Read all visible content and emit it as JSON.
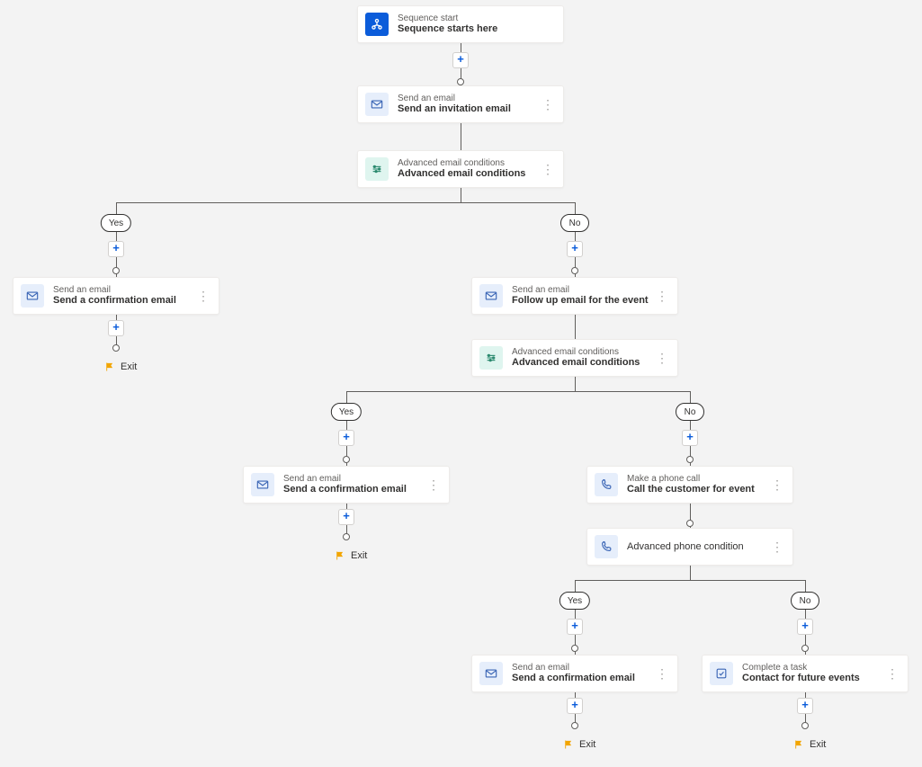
{
  "nodes": {
    "start": {
      "type": "Sequence start",
      "title": "Sequence starts here"
    },
    "invite": {
      "type": "Send an email",
      "title": "Send an invitation email"
    },
    "cond1": {
      "type": "Advanced email conditions",
      "title": "Advanced email conditions"
    },
    "confirmA": {
      "type": "Send an email",
      "title": "Send a confirmation email"
    },
    "follow": {
      "type": "Send an email",
      "title": "Follow up email for the event"
    },
    "cond2": {
      "type": "Advanced email conditions",
      "title": "Advanced email conditions"
    },
    "confirmB": {
      "type": "Send an email",
      "title": "Send a confirmation email"
    },
    "call": {
      "type": "Make a phone call",
      "title": "Call the customer for event"
    },
    "phoneCond": {
      "type": "",
      "title": "Advanced phone condition"
    },
    "confirmC": {
      "type": "Send an email",
      "title": "Send a confirmation email"
    },
    "task": {
      "type": "Complete a task",
      "title": "Contact for future events"
    }
  },
  "labels": {
    "yes": "Yes",
    "no": "No",
    "exit": "Exit"
  }
}
